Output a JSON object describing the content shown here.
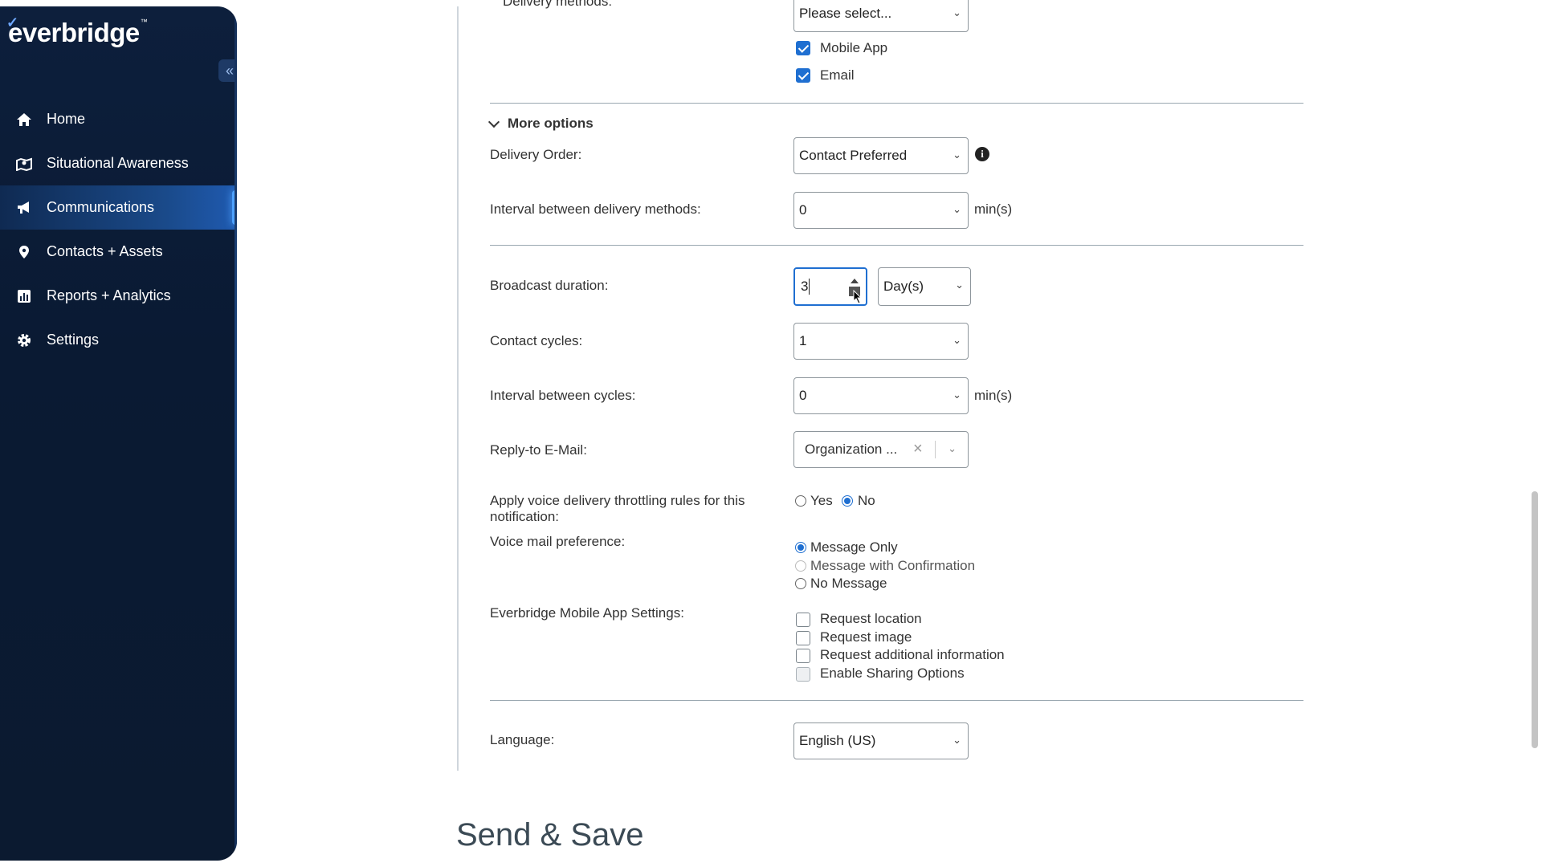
{
  "sidebar": {
    "logo": "everbridge",
    "logo_tm": "™",
    "collapse_symbol": "«",
    "items": [
      {
        "label": "Home",
        "icon": "home-icon"
      },
      {
        "label": "Situational Awareness",
        "icon": "map-icon"
      },
      {
        "label": "Communications",
        "icon": "megaphone-icon",
        "active": true
      },
      {
        "label": "Contacts + Assets",
        "icon": "location-pin-icon"
      },
      {
        "label": "Reports + Analytics",
        "icon": "chart-icon"
      },
      {
        "label": "Settings",
        "icon": "gear-icon"
      }
    ]
  },
  "form": {
    "delivery_methods": {
      "label": "Delivery methods:",
      "select_value": "Please select...",
      "options": [
        {
          "label": "Mobile App",
          "checked": true
        },
        {
          "label": "Email",
          "checked": true
        }
      ]
    },
    "more_options_label": "More options",
    "delivery_order": {
      "label": "Delivery Order:",
      "value": "Contact Preferred"
    },
    "interval_methods": {
      "label": "Interval between delivery methods:",
      "value": "0",
      "unit": "min(s)"
    },
    "broadcast_duration": {
      "label": "Broadcast duration:",
      "value": "3",
      "unit_value": "Day(s)"
    },
    "contact_cycles": {
      "label": "Contact cycles:",
      "value": "1"
    },
    "interval_cycles": {
      "label": "Interval between cycles:",
      "value": "0",
      "unit": "min(s)"
    },
    "reply_to": {
      "label": "Reply-to E-Mail:",
      "value": "Organization ..."
    },
    "throttling": {
      "label_line1": "Apply voice delivery throttling rules for this",
      "label_line2": "notification:",
      "yes": "Yes",
      "no": "No",
      "selected": "No"
    },
    "voicemail": {
      "label": "Voice mail preference:",
      "options": [
        "Message Only",
        "Message with Confirmation",
        "No Message"
      ],
      "selected": "Message Only"
    },
    "mobile_settings": {
      "label": "Everbridge Mobile App Settings:",
      "options": [
        "Request location",
        "Request image",
        "Request additional information",
        "Enable Sharing Options"
      ]
    },
    "language": {
      "label": "Language:",
      "value": "English (US)"
    }
  },
  "section_title": "Send & Save",
  "colors": {
    "accent": "#1f6fd1",
    "sidebar_bg": "#0d1f3c"
  }
}
